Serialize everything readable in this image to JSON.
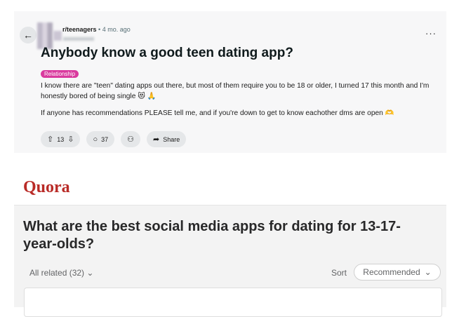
{
  "reddit": {
    "subreddit": "r/teenagers",
    "time_ago": "• 4 mo. ago",
    "more_icon": "···",
    "back_icon": "←",
    "title": "Anybody know a good teen dating app?",
    "flair": "Relationship",
    "paragraphs": [
      "I know there are \"teen\" dating apps out there, but most of them require you to be 18 or older, I turned 17 this month and I'm honestly bored of being single 😻 🙏",
      "If anyone has recommendations PLEASE tell me, and if you're down to get to know eachother dms are open 🫶"
    ],
    "actions": {
      "upvote_icon": "⇧",
      "score": "13",
      "downvote_icon": "⇩",
      "comment_icon": "○",
      "comments": "37",
      "award_icon": "⚇",
      "share_icon": "➦",
      "share_label": "Share"
    }
  },
  "quora": {
    "logo": "Quora",
    "question": "What are the best social media apps for dating for 13-17-year-olds?",
    "all_related": "All related (32)",
    "chevron": "⌄",
    "sort_label": "Sort",
    "sort_value": "Recommended"
  }
}
